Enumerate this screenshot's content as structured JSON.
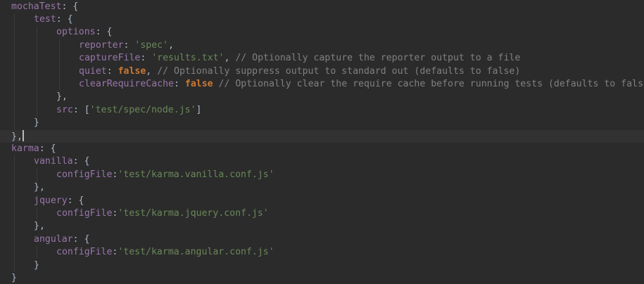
{
  "lines": [
    {
      "indent": 0,
      "tokens": [
        {
          "t": "k",
          "v": "mochaTest"
        },
        {
          "t": "p",
          "v": ": {"
        }
      ]
    },
    {
      "indent": 1,
      "tokens": [
        {
          "t": "k",
          "v": "test"
        },
        {
          "t": "p",
          "v": ": {"
        }
      ]
    },
    {
      "indent": 2,
      "tokens": [
        {
          "t": "k",
          "v": "options"
        },
        {
          "t": "p",
          "v": ": {"
        }
      ]
    },
    {
      "indent": 3,
      "tokens": [
        {
          "t": "k",
          "v": "reporter"
        },
        {
          "t": "p",
          "v": ": "
        },
        {
          "t": "s",
          "v": "'spec'"
        },
        {
          "t": "p",
          "v": ","
        }
      ]
    },
    {
      "indent": 3,
      "tokens": [
        {
          "t": "k",
          "v": "captureFile"
        },
        {
          "t": "p",
          "v": ": "
        },
        {
          "t": "s",
          "v": "'results.txt'"
        },
        {
          "t": "p",
          "v": ", "
        },
        {
          "t": "c",
          "v": "// Optionally capture the reporter output to a file"
        }
      ]
    },
    {
      "indent": 3,
      "tokens": [
        {
          "t": "k",
          "v": "quiet"
        },
        {
          "t": "p",
          "v": ": "
        },
        {
          "t": "b",
          "v": "false"
        },
        {
          "t": "p",
          "v": ", "
        },
        {
          "t": "c",
          "v": "// Optionally suppress output to standard out (defaults to false)"
        }
      ]
    },
    {
      "indent": 3,
      "tokens": [
        {
          "t": "k",
          "v": "clearRequireCache"
        },
        {
          "t": "p",
          "v": ": "
        },
        {
          "t": "b",
          "v": "false"
        },
        {
          "t": "p",
          "v": " "
        },
        {
          "t": "c",
          "v": "// Optionally clear the require cache before running tests (defaults to false)"
        }
      ]
    },
    {
      "indent": 2,
      "tokens": [
        {
          "t": "p",
          "v": "},"
        }
      ]
    },
    {
      "indent": 2,
      "tokens": [
        {
          "t": "k",
          "v": "src"
        },
        {
          "t": "p",
          "v": ": ["
        },
        {
          "t": "s",
          "v": "'test/spec/node.js'"
        },
        {
          "t": "p",
          "v": "]"
        }
      ]
    },
    {
      "indent": 1,
      "tokens": [
        {
          "t": "p",
          "v": "}"
        }
      ]
    },
    {
      "indent": 0,
      "current": true,
      "caret": true,
      "tokens": [
        {
          "t": "p",
          "v": "},"
        }
      ]
    },
    {
      "indent": 0,
      "tokens": [
        {
          "t": "k",
          "v": "karma"
        },
        {
          "t": "p",
          "v": ": {"
        }
      ]
    },
    {
      "indent": 1,
      "tokens": [
        {
          "t": "k",
          "v": "vanilla"
        },
        {
          "t": "p",
          "v": ": {"
        }
      ]
    },
    {
      "indent": 2,
      "tokens": [
        {
          "t": "k",
          "v": "configFile"
        },
        {
          "t": "p",
          "v": ":"
        },
        {
          "t": "s",
          "v": "'test/karma.vanilla.conf.js'"
        }
      ]
    },
    {
      "indent": 1,
      "tokens": [
        {
          "t": "p",
          "v": "},"
        }
      ]
    },
    {
      "indent": 1,
      "tokens": [
        {
          "t": "k",
          "v": "jquery"
        },
        {
          "t": "p",
          "v": ": {"
        }
      ]
    },
    {
      "indent": 2,
      "tokens": [
        {
          "t": "k",
          "v": "configFile"
        },
        {
          "t": "p",
          "v": ":"
        },
        {
          "t": "s",
          "v": "'test/karma.jquery.conf.js'"
        }
      ]
    },
    {
      "indent": 1,
      "tokens": [
        {
          "t": "p",
          "v": "},"
        }
      ]
    },
    {
      "indent": 1,
      "tokens": [
        {
          "t": "k",
          "v": "angular"
        },
        {
          "t": "p",
          "v": ": {"
        }
      ]
    },
    {
      "indent": 2,
      "tokens": [
        {
          "t": "k",
          "v": "configFile"
        },
        {
          "t": "p",
          "v": ":"
        },
        {
          "t": "s",
          "v": "'test/karma.angular.conf.js'"
        }
      ]
    },
    {
      "indent": 1,
      "tokens": [
        {
          "t": "p",
          "v": "}"
        }
      ]
    },
    {
      "indent": 0,
      "tokens": [
        {
          "t": "p",
          "v": "}"
        }
      ]
    }
  ],
  "colors": {
    "background": "#2b2b2b",
    "current_line": "#323232",
    "key": "#9876aa",
    "string": "#6a8759",
    "keyword": "#cc7832",
    "comment": "#808080",
    "text": "#a9b7c6"
  }
}
